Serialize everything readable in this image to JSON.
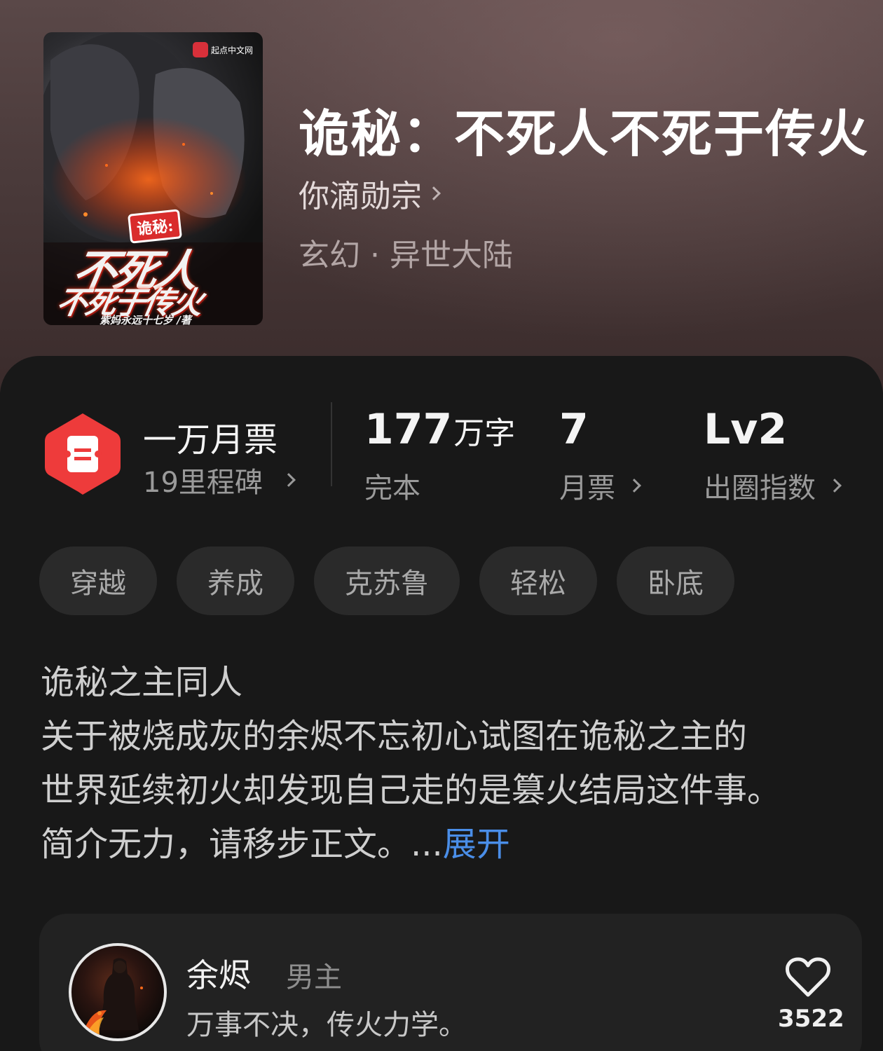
{
  "book": {
    "title": "诡秘：不死人不死于传火",
    "author": "你滴勋宗",
    "genre": "玄幻 · 异世大陆",
    "cover": {
      "brand": "起点中文网",
      "tag": "诡秘:",
      "line1": "不死人",
      "line2": "不死于传火",
      "byline": "紫妈永远十七岁 /著"
    }
  },
  "stats": {
    "monthly_ticket_title": "一万月票",
    "milestone": "19里程碑",
    "word_count": "177",
    "word_unit": "万字",
    "status": "完本",
    "monthly_tickets": "7",
    "monthly_tickets_label": "月票",
    "level": "Lv2",
    "level_label": "出圈指数"
  },
  "tags": [
    "穿越",
    "养成",
    "克苏鲁",
    "轻松",
    "卧底"
  ],
  "description": {
    "line1": "诡秘之主同人",
    "line2": "关于被烧成灰的余烬不忘初心试图在诡秘之主的",
    "line3": "世界延续初火却发现自己走的是篡火结局这件事。",
    "line4": "简介无力，请移步正文。...",
    "expand": "展开"
  },
  "character": {
    "name": "余烬",
    "role": "男主",
    "quote": "万事不决，传火力学。",
    "likes": "3522"
  },
  "colors": {
    "accent_link": "#4a8ee8",
    "ticket_red": "#ee3b3b",
    "sheet_bg": "#181818",
    "tag_bg": "#2a2a2a"
  }
}
